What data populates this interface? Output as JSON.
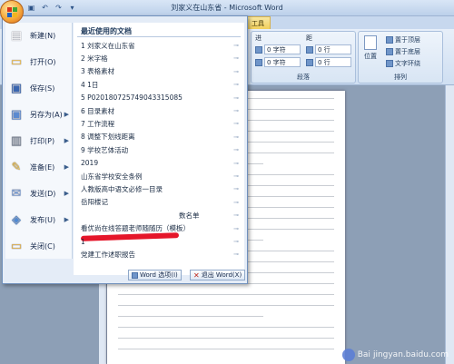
{
  "titlebar": {
    "title": "刘家义在山东省 - Microsoft Word"
  },
  "ribbon": {
    "context_tab": "工具",
    "paragraph_group": {
      "label": "段落",
      "indent_left": "0 字符",
      "indent_right": "0 字符",
      "spacing_before": "0 行",
      "spacing_after": "0 行",
      "section_label_left": "进",
      "section_label_right": "距"
    },
    "arrange_group": {
      "label": "排列",
      "items": [
        "置于顶层",
        "置于底层",
        "文字环绕"
      ]
    },
    "position_label": "位置"
  },
  "menu": {
    "left_items": [
      {
        "label": "新建(N)",
        "icon": "new-document-icon",
        "has_arrow": false
      },
      {
        "label": "打开(O)",
        "icon": "open-folder-icon",
        "has_arrow": false
      },
      {
        "label": "保存(S)",
        "icon": "save-icon",
        "has_arrow": false
      },
      {
        "label": "另存为(A)",
        "icon": "save-as-icon",
        "has_arrow": true
      },
      {
        "label": "打印(P)",
        "icon": "print-icon",
        "has_arrow": true
      },
      {
        "label": "准备(E)",
        "icon": "prepare-icon",
        "has_arrow": true
      },
      {
        "label": "发送(D)",
        "icon": "send-icon",
        "has_arrow": true
      },
      {
        "label": "发布(U)",
        "icon": "publish-icon",
        "has_arrow": true
      },
      {
        "label": "关闭(C)",
        "icon": "close-folder-icon",
        "has_arrow": false
      }
    ],
    "recent_header": "最近使用的文档",
    "recent_items": [
      "1 刘家义在山东省",
      "2 米字格",
      "3 表格素材",
      "4 1日",
      "5 P020180725749043315085",
      "6 目录素材",
      "7 工作流程",
      "8 调整下划线距离",
      "9 学校艺体活动",
      "2019",
      "山东省学校安全条例",
      "人教版高中语文必修一目录",
      "岳阳楼记",
      "数名单",
      "看优尚在线答题老师随随历（模板）",
      "1",
      "党建工作述职报告"
    ],
    "word_options": "Word 选项(I)",
    "exit_word": "退出 Word(X)"
  },
  "watermark": {
    "text": "jingyan.baidu.com",
    "brand": "Bai"
  }
}
